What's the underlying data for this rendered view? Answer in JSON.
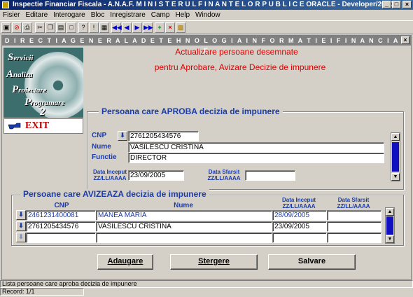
{
  "window": {
    "title": "Inspectie Financiar Fiscala - A.N.A.F.  M I N I S T E R U L   F I N A N T E L O R   P U B L I C E  ORACLE - Developer/2000",
    "min": "_",
    "max": "□",
    "close": "×"
  },
  "menu": [
    "Fisier",
    "Editare",
    "Interogare",
    "Bloc",
    "Inregistrare",
    "Camp",
    "Help",
    "Window"
  ],
  "toolbar_icons": [
    "save-icon",
    "exit-icon",
    "print-icon",
    "cut-icon",
    "copy-icon",
    "paste-icon",
    "clear-icon",
    "enter-query-icon",
    "execute-query-icon",
    "query-icon",
    "first-record-icon",
    "previous-record-icon",
    "next-record-icon",
    "last-record-icon",
    "insert-record-icon",
    "delete-record-icon",
    "lock-icon"
  ],
  "form": {
    "title": "D I R E C T I A   G E N E R A L A   D E   T E H N O L O G I A   I N F O R M A T I E I   F I N A N C I A R E",
    "close": "×",
    "heading_line1": "Actualizare persoane desemnate",
    "heading_line2": "pentru Aprobare, Avizare Decizie de impunere",
    "logo": [
      "S",
      "ervicii",
      "A",
      "naliza",
      "P",
      "roiectare",
      "P",
      "rogramare",
      "2"
    ],
    "exit_label": "EXIT"
  },
  "approver": {
    "group_title": "Persoana care APROBA decizia de impunere",
    "cnp_label": "CNP",
    "nume_label": "Nume",
    "functie_label": "Functie",
    "cnp": "2761205434576",
    "nume": "VASILESCU CRISTINA",
    "functie": "DIRECTOR",
    "data_inceput_label": "Data Inceput",
    "data_inceput_format": "ZZ/LL/AAAA",
    "data_inceput": "23/09/2005",
    "data_sfarsit_label": "Data Sfarsit",
    "data_sfarsit_format": "ZZ/LL/AAAA",
    "data_sfarsit": ""
  },
  "reviewers": {
    "group_title": "Persoane care AVIZEAZA decizia de impunere",
    "headers": {
      "cnp": "CNP",
      "nume": "Nume",
      "data_inceput": "Data Inceput",
      "data_inceput_format": "ZZ/LL/AAAA",
      "data_sfarsit": "Data Sfarsit",
      "data_sfarsit_format": "ZZ/LL/AAAA"
    },
    "rows": [
      {
        "cnp": "2461231400081",
        "nume": "MANEA MARIA",
        "data_inceput": "28/09/2005",
        "data_sfarsit": ""
      },
      {
        "cnp": "2761205434576",
        "nume": "VASILESCU CRISTINA",
        "data_inceput": "23/09/2005",
        "data_sfarsit": ""
      },
      {
        "cnp": "",
        "nume": "",
        "data_inceput": "",
        "data_sfarsit": ""
      }
    ]
  },
  "buttons": {
    "add": "Adaugare",
    "delete": "Stergere",
    "save": "Salvare"
  },
  "status": {
    "hint": "Lista persoane care aproba decizia de impunere",
    "record": "Record: 1/1"
  },
  "colors": {
    "title_blue": "#0a246a",
    "label_blue": "#1a3caa",
    "heading_red": "#e00000",
    "scroll_thumb": "#1010c0"
  }
}
